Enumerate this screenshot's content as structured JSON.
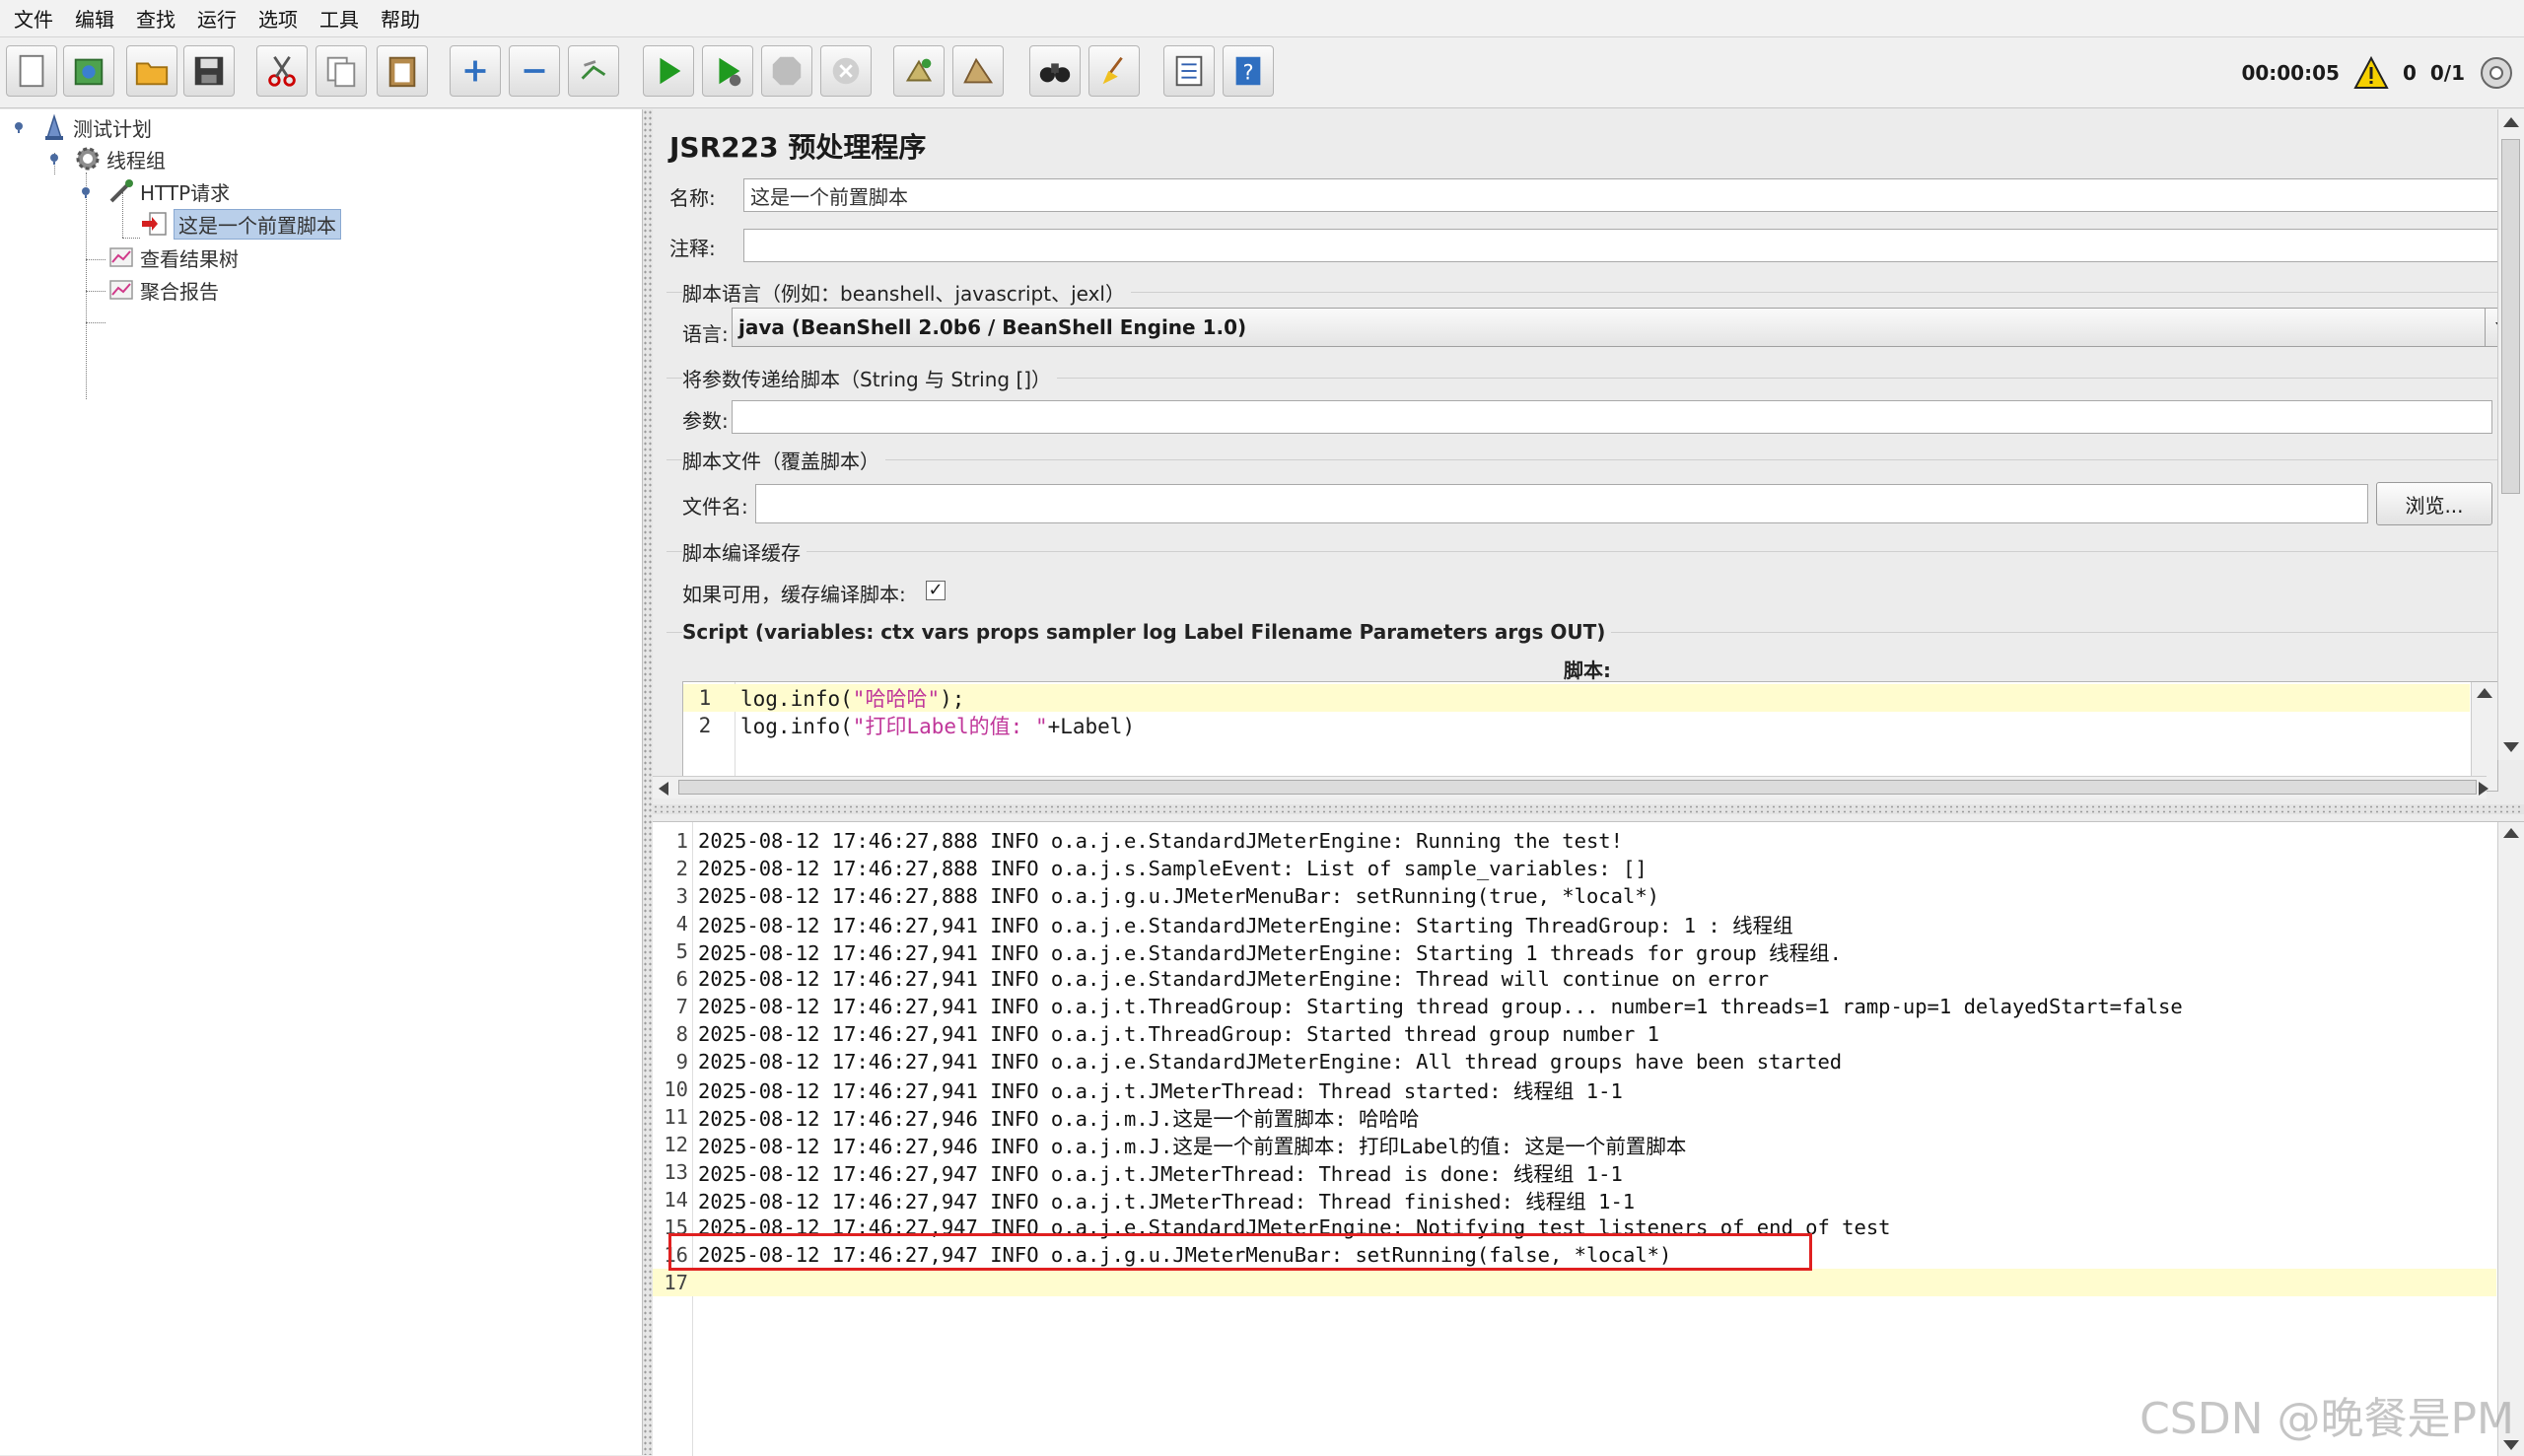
{
  "menu": [
    "文件",
    "编辑",
    "查找",
    "运行",
    "选项",
    "工具",
    "帮助"
  ],
  "status": {
    "timer": "00:00:05",
    "warnings": "0",
    "threads": "0/1"
  },
  "tree": {
    "items": [
      {
        "label": "测试计划"
      },
      {
        "label": "线程组"
      },
      {
        "label": "HTTP请求"
      },
      {
        "label": "这是一个前置脚本"
      },
      {
        "label": "查看结果树"
      },
      {
        "label": "聚合报告"
      }
    ]
  },
  "panel": {
    "title": "JSR223 预处理程序",
    "name_label": "名称:",
    "name_value": "这是一个前置脚本",
    "comment_label": "注释:",
    "comment_value": "",
    "lang_section": "脚本语言（例如：beanshell、javascript、jexl）",
    "lang_label": "语言:",
    "lang_value": "java     (BeanShell 2.0b6 / BeanShell Engine 1.0)",
    "params_section": "将参数传递给脚本（String 与 String []）",
    "params_label": "参数:",
    "params_value": "",
    "file_section": "脚本文件（覆盖脚本）",
    "file_label": "文件名:",
    "file_value": "",
    "browse_label": "浏览...",
    "cache_section": "脚本编译缓存",
    "cache_label": "如果可用，缓存编译脚本:",
    "cache_checked": "✓",
    "script_section": "Script (variables: ctx vars props sampler log Label Filename Parameters args OUT)",
    "script_label": "脚本:"
  },
  "script": {
    "lines": [
      {
        "n": "1",
        "pre": "log.info(",
        "str": "\"哈哈哈\"",
        "post": ");"
      },
      {
        "n": "2",
        "pre": "log.info(",
        "str": "\"打印Label的值: \"",
        "post": "+Label)"
      }
    ]
  },
  "log": {
    "lines": [
      {
        "n": "1",
        "text": "2025-08-12 17:46:27,888 INFO o.a.j.e.StandardJMeterEngine: Running the test!"
      },
      {
        "n": "2",
        "text": "2025-08-12 17:46:27,888 INFO o.a.j.s.SampleEvent: List of sample_variables: []"
      },
      {
        "n": "3",
        "text": "2025-08-12 17:46:27,888 INFO o.a.j.g.u.JMeterMenuBar: setRunning(true, *local*)"
      },
      {
        "n": "4",
        "text": "2025-08-12 17:46:27,941 INFO o.a.j.e.StandardJMeterEngine: Starting ThreadGroup: 1 : 线程组"
      },
      {
        "n": "5",
        "text": "2025-08-12 17:46:27,941 INFO o.a.j.e.StandardJMeterEngine: Starting 1 threads for group 线程组."
      },
      {
        "n": "6",
        "text": "2025-08-12 17:46:27,941 INFO o.a.j.e.StandardJMeterEngine: Thread will continue on error"
      },
      {
        "n": "7",
        "text": "2025-08-12 17:46:27,941 INFO o.a.j.t.ThreadGroup: Starting thread group... number=1 threads=1 ramp-up=1 delayedStart=false"
      },
      {
        "n": "8",
        "text": "2025-08-12 17:46:27,941 INFO o.a.j.t.ThreadGroup: Started thread group number 1"
      },
      {
        "n": "9",
        "text": "2025-08-12 17:46:27,941 INFO o.a.j.e.StandardJMeterEngine: All thread groups have been started"
      },
      {
        "n": "10",
        "text": "2025-08-12 17:46:27,941 INFO o.a.j.t.JMeterThread: Thread started: 线程组 1-1"
      },
      {
        "n": "11",
        "text": "2025-08-12 17:46:27,946 INFO o.a.j.m.J.这是一个前置脚本: 哈哈哈"
      },
      {
        "n": "12",
        "text": "2025-08-12 17:46:27,946 INFO o.a.j.m.J.这是一个前置脚本: 打印Label的值: 这是一个前置脚本"
      },
      {
        "n": "13",
        "text": "2025-08-12 17:46:27,947 INFO o.a.j.t.JMeterThread: Thread is done: 线程组 1-1"
      },
      {
        "n": "14",
        "text": "2025-08-12 17:46:27,947 INFO o.a.j.t.JMeterThread: Thread finished: 线程组 1-1"
      },
      {
        "n": "15",
        "text": "2025-08-12 17:46:27,947 INFO o.a.j.e.StandardJMeterEngine: Notifying test listeners of end of test"
      },
      {
        "n": "16",
        "text": "2025-08-12 17:46:27,947 INFO o.a.j.g.u.JMeterMenuBar: setRunning(false, *local*)"
      },
      {
        "n": "17",
        "text": ""
      }
    ]
  },
  "watermark": "CSDN @晚餐是PM",
  "colors": {
    "selection": "#b9cfea",
    "current_line": "#fffccf",
    "highlight_box": "#e02020",
    "string": "#c0379a"
  }
}
